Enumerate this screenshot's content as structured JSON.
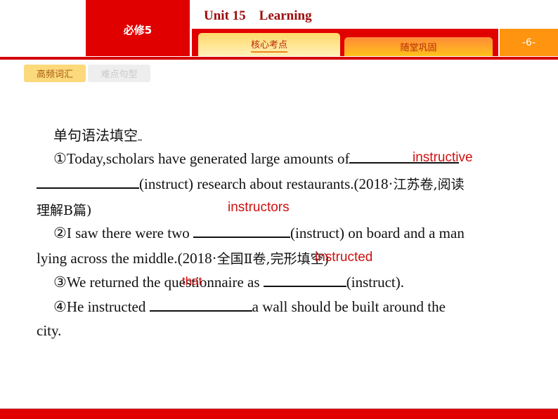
{
  "header": {
    "book": "必修5",
    "unit_title": "Unit 15    Learning",
    "tabs": [
      {
        "label": "核心考点",
        "active": true
      },
      {
        "label": "随堂巩固",
        "active": false
      }
    ],
    "page_number": "-6-"
  },
  "subtabs": [
    {
      "label": "高频词汇",
      "active": true
    },
    {
      "label": "难点句型",
      "active": false
    }
  ],
  "exercise": {
    "heading": "单句语法填空",
    "items": {
      "q1_line1": "①Today,scholars have generated large amounts of",
      "q1_line2_rest": "(instruct) research about restaurants.(2018·",
      "q1_line2_cn": "江苏卷,阅读",
      "q1_line3": "理解B篇)",
      "q2_line1_a": "②I saw there were two ",
      "q2_line1_b": "(instruct) on board and a man",
      "q2_line2_a": "lying across the middle.(2018·",
      "q2_line2_cn": "全国Ⅱ卷,完形填空",
      "q2_line2_end": ")",
      "q3_a": "③We returned the questionnaire as ",
      "q3_b": "(instruct).",
      "q4_a": "④He instructed ",
      "q4_b": "a wall should be built around the",
      "q4_line2": "city."
    },
    "answers": {
      "a1": "instructive",
      "a2": "instructors",
      "a3": "instructed",
      "a4": "that"
    }
  },
  "colors": {
    "brand_red": "#e00000",
    "answer_red": "#d00f0f",
    "title_red": "#9b0a0a",
    "page_orange": "#ff9410"
  }
}
